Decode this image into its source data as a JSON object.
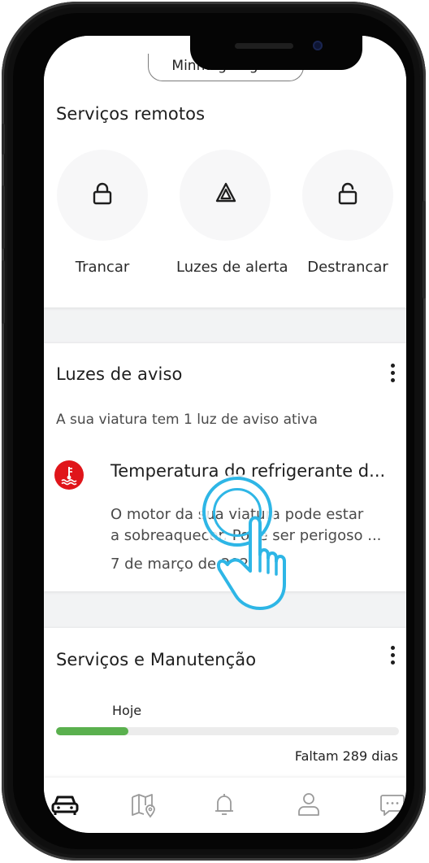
{
  "header": {
    "garage_label": "Minha garagem"
  },
  "remote_services": {
    "title": "Serviços remotos",
    "items": [
      {
        "label": "Trancar",
        "icon": "lock-icon"
      },
      {
        "label": "Luzes de alerta",
        "icon": "hazard-triangle-icon"
      },
      {
        "label": "Destrancar",
        "icon": "unlock-icon"
      }
    ]
  },
  "warning_lights": {
    "title": "Luzes de aviso",
    "summary": "A sua viatura tem 1 luz de aviso ativa",
    "alert": {
      "title": "Temperatura do refrigerante d...",
      "description_line1": "O motor da sua viatura pode estar",
      "description_line2": "a sobreaquecer. Pode ser perigoso ...",
      "date": "7 de março de 2024",
      "icon": "coolant-temperature-icon",
      "icon_color": "#e0151a"
    }
  },
  "service_maintenance": {
    "title": "Serviços e Manutenção",
    "progress_label": "Hoje",
    "progress_fraction": 0.21,
    "progress_color": "#5ab04e",
    "remaining_text": "Faltam 289 dias"
  },
  "bottom_nav": [
    {
      "icon": "car-icon",
      "active": true
    },
    {
      "icon": "map-icon",
      "active": false
    },
    {
      "icon": "bell-icon",
      "active": false
    },
    {
      "icon": "profile-icon",
      "active": false
    },
    {
      "icon": "chat-icon",
      "active": false
    }
  ],
  "colors": {
    "accent": "#2eb6e6",
    "alert_red": "#e0151a",
    "progress_green": "#5ab04e"
  }
}
